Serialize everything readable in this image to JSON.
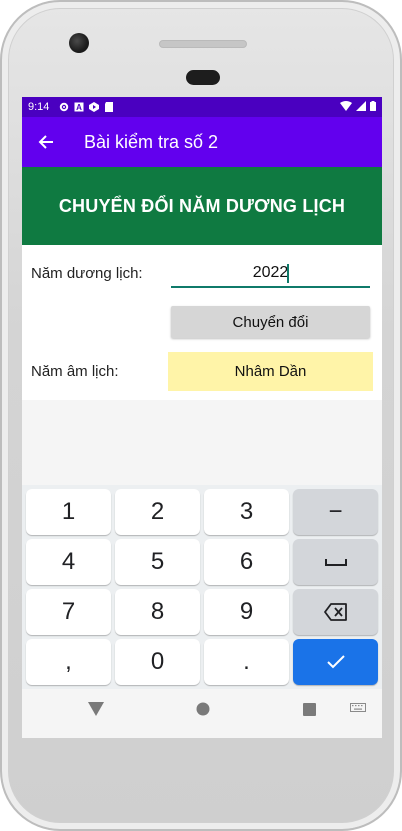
{
  "status_bar": {
    "time": "9:14",
    "bg_color": "#4a00c0",
    "left_icons": [
      "gear-icon",
      "a-icon",
      "play-icon",
      "sd-card-icon"
    ],
    "right_icons": [
      "wifi-icon",
      "signal-icon",
      "battery-icon"
    ]
  },
  "app_bar": {
    "title": "Bài kiểm tra số 2",
    "back_icon": "arrow-back-icon",
    "color": "#6200ee"
  },
  "header": {
    "title": "CHUYỂN ĐỔI NĂM DƯƠNG LỊCH",
    "color": "#0f7a41"
  },
  "form": {
    "solar_year_label": "Năm dương lịch:",
    "solar_year_value": "2022",
    "convert_button": "Chuyển đổi",
    "lunar_year_label": "Năm âm lịch:",
    "lunar_year_value": "Nhâm Dần",
    "result_color": "#fff4a8"
  },
  "keyboard": {
    "rows": [
      [
        "1",
        "2",
        "3",
        "−"
      ],
      [
        "4",
        "5",
        "6",
        "space"
      ],
      [
        "7",
        "8",
        "9",
        "backspace"
      ],
      [
        ",",
        "0",
        ".",
        "enter"
      ]
    ],
    "enter_color": "#1a73e8"
  },
  "nav_bar": {
    "icons": [
      "back-triangle-icon",
      "home-circle-icon",
      "recents-square-icon",
      "keyboard-icon"
    ]
  }
}
